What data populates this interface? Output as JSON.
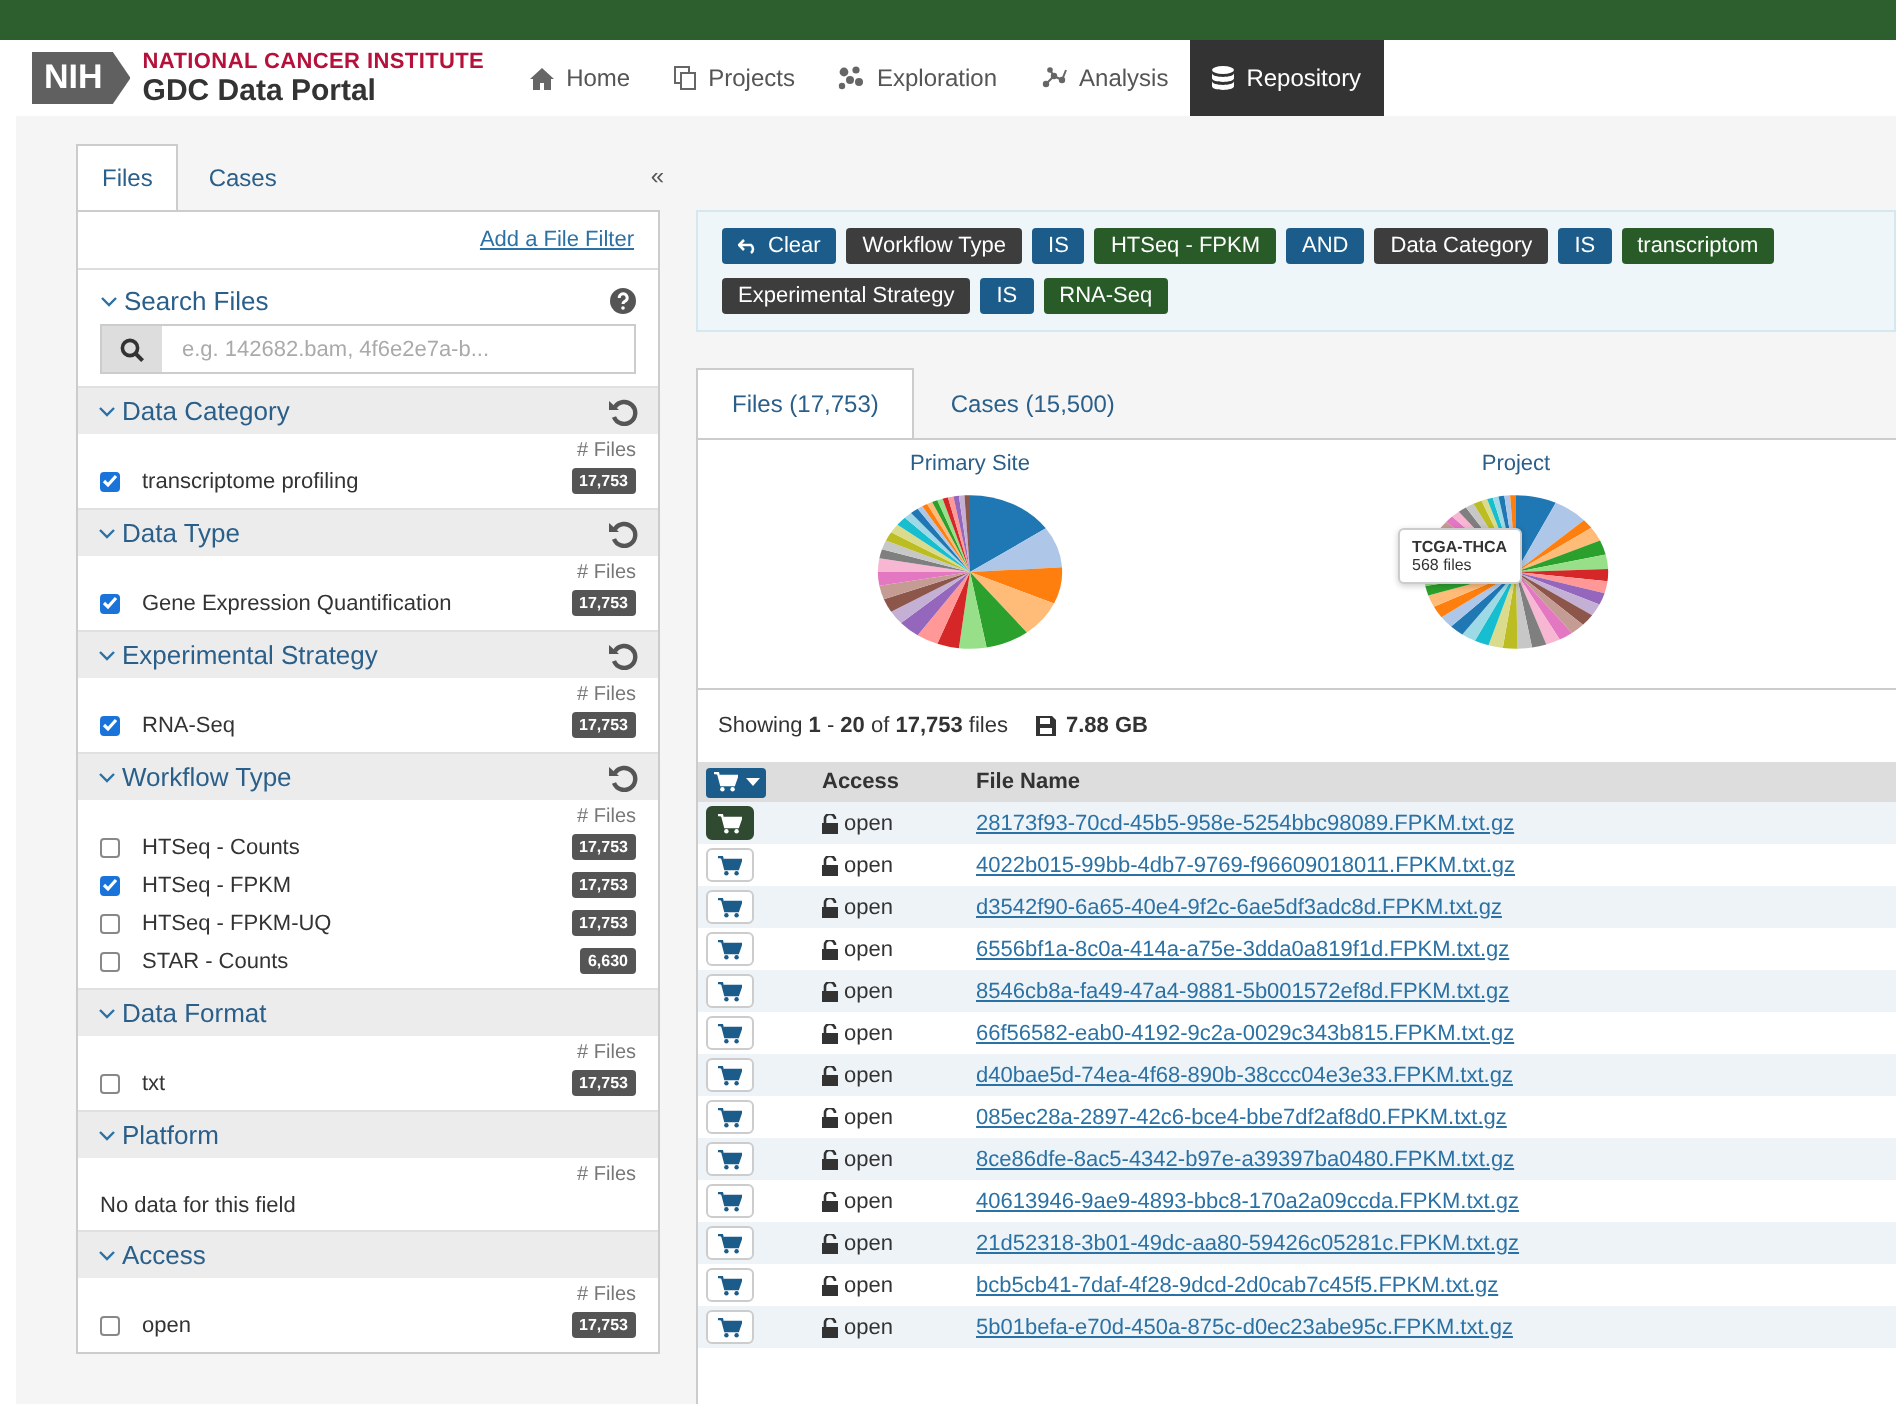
{
  "nav": {
    "logo_mark": "NIH",
    "logo_title": "NATIONAL CANCER INSTITUTE",
    "logo_subtitle": "GDC Data Portal",
    "items": [
      {
        "label": "Home",
        "selected": false
      },
      {
        "label": "Projects",
        "selected": false
      },
      {
        "label": "Exploration",
        "selected": false
      },
      {
        "label": "Analysis",
        "selected": false
      },
      {
        "label": "Repository",
        "selected": true
      }
    ]
  },
  "sidebar": {
    "tabs": [
      {
        "label": "Files",
        "selected": true
      },
      {
        "label": "Cases",
        "selected": false
      }
    ],
    "collapse": "«",
    "add_filter": "Add a File Filter",
    "search": {
      "title": "Search Files",
      "placeholder": "e.g. 142682.bam, 4f6e2e7a-b..."
    },
    "facets": [
      {
        "title": "Data Category",
        "resettable": true,
        "count_label": "# Files",
        "items": [
          {
            "label": "transcriptome profiling",
            "count": "17,753",
            "checked": true
          }
        ]
      },
      {
        "title": "Data Type",
        "resettable": true,
        "count_label": "# Files",
        "items": [
          {
            "label": "Gene Expression Quantification",
            "count": "17,753",
            "checked": true
          }
        ]
      },
      {
        "title": "Experimental Strategy",
        "resettable": true,
        "count_label": "# Files",
        "items": [
          {
            "label": "RNA-Seq",
            "count": "17,753",
            "checked": true
          }
        ]
      },
      {
        "title": "Workflow Type",
        "resettable": true,
        "count_label": "# Files",
        "items": [
          {
            "label": "HTSeq - Counts",
            "count": "17,753",
            "checked": false
          },
          {
            "label": "HTSeq - FPKM",
            "count": "17,753",
            "checked": true
          },
          {
            "label": "HTSeq - FPKM-UQ",
            "count": "17,753",
            "checked": false
          },
          {
            "label": "STAR - Counts",
            "count": "6,630",
            "checked": false
          }
        ]
      },
      {
        "title": "Data Format",
        "resettable": false,
        "count_label": "# Files",
        "items": [
          {
            "label": "txt",
            "count": "17,753",
            "checked": false
          }
        ]
      },
      {
        "title": "Platform",
        "resettable": false,
        "count_label": "# Files",
        "empty_text": "No data for this field"
      },
      {
        "title": "Access",
        "resettable": false,
        "count_label": "# Files",
        "items": [
          {
            "label": "open",
            "count": "17,753",
            "checked": false
          }
        ]
      }
    ]
  },
  "query": {
    "clear": "Clear",
    "lines": [
      [
        {
          "text": "Workflow Type",
          "kind": "field"
        },
        {
          "text": "IS",
          "kind": "op"
        },
        {
          "text": "HTSeq - FPKM",
          "kind": "value"
        },
        {
          "text": "AND",
          "kind": "op"
        },
        {
          "text": "Data Category",
          "kind": "field"
        },
        {
          "text": "IS",
          "kind": "op"
        },
        {
          "text": "transcriptom",
          "kind": "value"
        }
      ],
      [
        {
          "text": "Experimental Strategy",
          "kind": "field"
        },
        {
          "text": "IS",
          "kind": "op"
        },
        {
          "text": "RNA-Seq",
          "kind": "value"
        }
      ]
    ]
  },
  "tabs": [
    {
      "label": "Files (17,753)",
      "selected": true
    },
    {
      "label": "Cases (15,500)",
      "selected": false
    }
  ],
  "charts": [
    {
      "title": "Primary Site"
    },
    {
      "title": "Project",
      "tooltip": {
        "title": "TCGA-THCA",
        "text": "568 files"
      }
    }
  ],
  "summary": {
    "text": "Showing **1** - **20** of **17,753** files",
    "size": "7.88 GB"
  },
  "table": {
    "columns": [
      "Access",
      "File Name"
    ],
    "rows": [
      {
        "in_cart": true,
        "access": "open",
        "file_name": "28173f93-70cd-45b5-958e-5254bbc98089.FPKM.txt.gz"
      },
      {
        "in_cart": false,
        "access": "open",
        "file_name": "4022b015-99bb-4db7-9769-f96609018011.FPKM.txt.gz"
      },
      {
        "in_cart": false,
        "access": "open",
        "file_name": "d3542f90-6a65-40e4-9f2c-6ae5df3adc8d.FPKM.txt.gz"
      },
      {
        "in_cart": false,
        "access": "open",
        "file_name": "6556bf1a-8c0a-414a-a75e-3dda0a819f1d.FPKM.txt.gz"
      },
      {
        "in_cart": false,
        "access": "open",
        "file_name": "8546cb8a-fa49-47a4-9881-5b001572ef8d.FPKM.txt.gz"
      },
      {
        "in_cart": false,
        "access": "open",
        "file_name": "66f56582-eab0-4192-9c2a-0029c343b815.FPKM.txt.gz"
      },
      {
        "in_cart": false,
        "access": "open",
        "file_name": "d40bae5d-74ea-4f68-890b-38ccc04e3e33.FPKM.txt.gz"
      },
      {
        "in_cart": false,
        "access": "open",
        "file_name": "085ec28a-2897-42c6-bce4-bbe7df2af8d0.FPKM.txt.gz"
      },
      {
        "in_cart": false,
        "access": "open",
        "file_name": "8ce86dfe-8ac5-4342-b97e-a39397ba0480.FPKM.txt.gz"
      },
      {
        "in_cart": false,
        "access": "open",
        "file_name": "40613946-9ae9-4893-bbc8-170a2a09ccda.FPKM.txt.gz"
      },
      {
        "in_cart": false,
        "access": "open",
        "file_name": "21d52318-3b01-49dc-aa80-59426c05281c.FPKM.txt.gz"
      },
      {
        "in_cart": false,
        "access": "open",
        "file_name": "bcb5cb41-7daf-4f28-9dcd-2d0cab7c45f5.FPKM.txt.gz"
      },
      {
        "in_cart": false,
        "access": "open",
        "file_name": "5b01befa-e70d-450a-875c-d0ec23abe95c.FPKM.txt.gz"
      }
    ]
  }
}
